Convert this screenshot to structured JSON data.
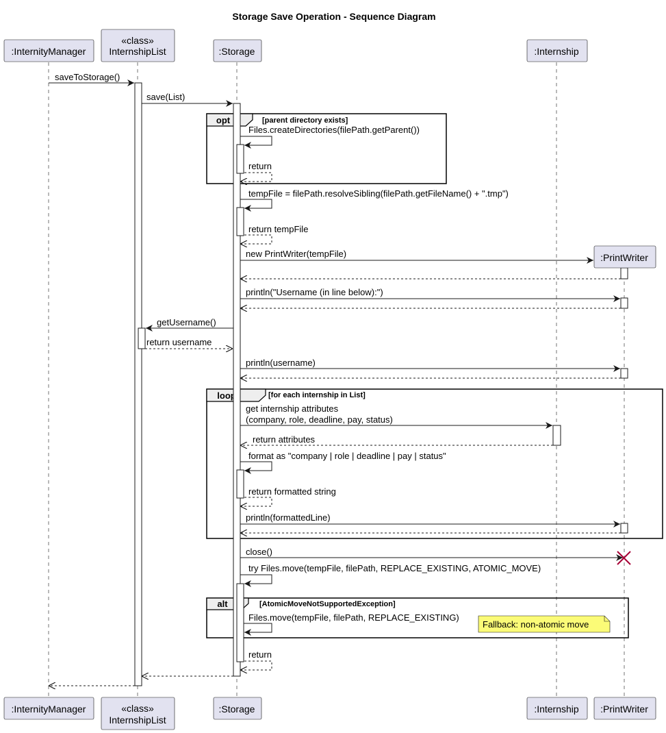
{
  "title": "Storage Save Operation - Sequence Diagram",
  "participants": [
    {
      "stereotype": "",
      "name": ":InternityManager"
    },
    {
      "stereotype": "«class»",
      "name": "InternshipList"
    },
    {
      "stereotype": "",
      "name": ":Storage"
    },
    {
      "stereotype": "",
      "name": ":Internship"
    },
    {
      "stereotype": "",
      "name": ":PrintWriter"
    }
  ],
  "messages": [
    {
      "from": 0,
      "to": 1,
      "text": "saveToStorage()",
      "kind": "sync"
    },
    {
      "from": 1,
      "to": 2,
      "text": "save(List)",
      "kind": "sync"
    },
    {
      "from": 2,
      "to": 2,
      "text": "Files.createDirectories(filePath.getParent())",
      "kind": "self"
    },
    {
      "from": 2,
      "to": 2,
      "text": "return",
      "kind": "self-return"
    },
    {
      "from": 2,
      "to": 2,
      "text": "tempFile = filePath.resolveSibling(filePath.getFileName() + \".tmp\")",
      "kind": "self"
    },
    {
      "from": 2,
      "to": 2,
      "text": "return tempFile",
      "kind": "self-return"
    },
    {
      "from": 2,
      "to": 4,
      "text": "new PrintWriter(tempFile)",
      "kind": "create"
    },
    {
      "from": 4,
      "to": 2,
      "text": "",
      "kind": "return"
    },
    {
      "from": 2,
      "to": 4,
      "text": "println(\"Username (in line below):\")",
      "kind": "sync"
    },
    {
      "from": 4,
      "to": 2,
      "text": "",
      "kind": "return"
    },
    {
      "from": 2,
      "to": 1,
      "text": "getUsername()",
      "kind": "sync"
    },
    {
      "from": 1,
      "to": 2,
      "text": "return username",
      "kind": "return"
    },
    {
      "from": 2,
      "to": 4,
      "text": "println(username)",
      "kind": "sync"
    },
    {
      "from": 4,
      "to": 2,
      "text": "",
      "kind": "return"
    },
    {
      "from": 2,
      "to": 3,
      "text": "get internship attributes",
      "text2": "(company, role, deadline, pay, status)",
      "kind": "sync"
    },
    {
      "from": 3,
      "to": 2,
      "text": "return attributes",
      "kind": "return"
    },
    {
      "from": 2,
      "to": 2,
      "text": "format as \"company | role | deadline | pay | status\"",
      "kind": "self"
    },
    {
      "from": 2,
      "to": 2,
      "text": "return formatted string",
      "kind": "self-return"
    },
    {
      "from": 2,
      "to": 4,
      "text": "println(formattedLine)",
      "kind": "sync"
    },
    {
      "from": 4,
      "to": 2,
      "text": "",
      "kind": "return"
    },
    {
      "from": 2,
      "to": 4,
      "text": "close()",
      "kind": "destroy"
    },
    {
      "from": 2,
      "to": 2,
      "text": "try Files.move(tempFile, filePath, REPLACE_EXISTING, ATOMIC_MOVE)",
      "kind": "self"
    },
    {
      "from": 2,
      "to": 2,
      "text": "Files.move(tempFile, filePath, REPLACE_EXISTING)",
      "kind": "self"
    },
    {
      "from": 2,
      "to": 2,
      "text": "return",
      "kind": "self-return"
    },
    {
      "from": 2,
      "to": 1,
      "text": "",
      "kind": "return"
    },
    {
      "from": 1,
      "to": 0,
      "text": "",
      "kind": "return"
    }
  ],
  "fragments": [
    {
      "keyword": "opt",
      "condition": "[parent directory exists]"
    },
    {
      "keyword": "loop",
      "condition": "[for each internship in List]"
    },
    {
      "keyword": "alt",
      "condition": "[AtomicMoveNotSupportedException]"
    }
  ],
  "note": "Fallback: non-atomic move",
  "colors": {
    "participant_fill": "#e2e2f0",
    "participant_border": "#181818",
    "note_fill": "#fbfb77",
    "destroy": "#a80036",
    "line": "#181818"
  }
}
